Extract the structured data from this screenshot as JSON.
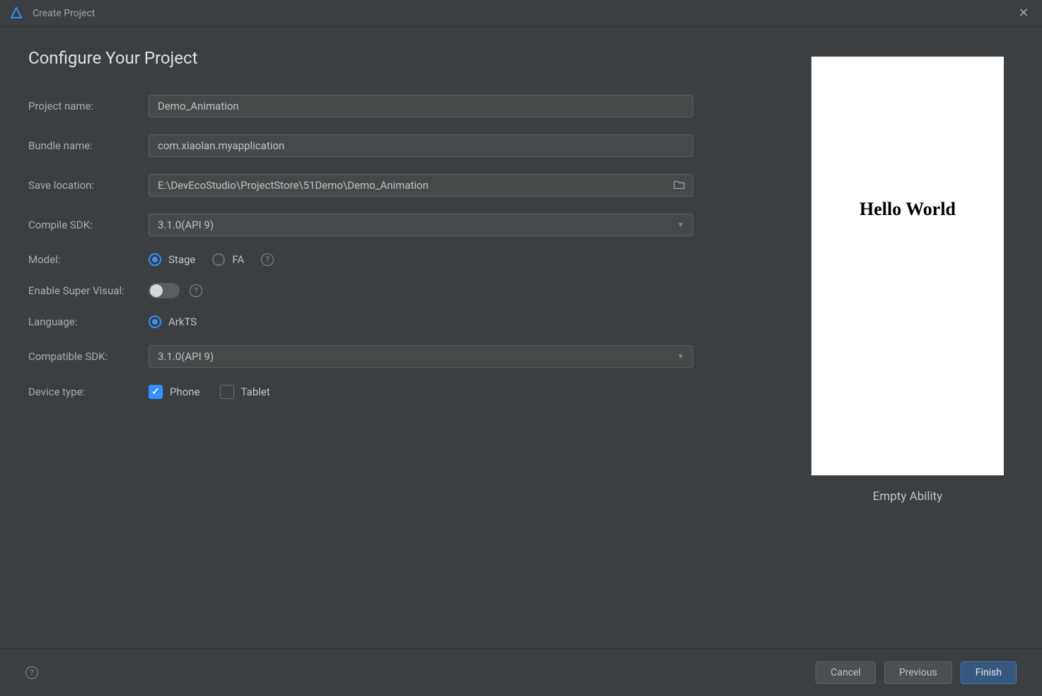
{
  "window": {
    "title": "Create Project"
  },
  "heading": "Configure Your Project",
  "form": {
    "project_name": {
      "label": "Project name:",
      "value": "Demo_Animation"
    },
    "bundle_name": {
      "label": "Bundle name:",
      "value": "com.xiaolan.myapplication"
    },
    "save_location": {
      "label": "Save location:",
      "value": "E:\\DevEcoStudio\\ProjectStore\\51Demo\\Demo_Animation"
    },
    "compile_sdk": {
      "label": "Compile SDK:",
      "value": "3.1.0(API 9)"
    },
    "model": {
      "label": "Model:",
      "options": {
        "stage": "Stage",
        "fa": "FA"
      },
      "selected": "stage"
    },
    "enable_super_visual": {
      "label": "Enable Super Visual:",
      "enabled": false
    },
    "language": {
      "label": "Language:",
      "options": {
        "arkts": "ArkTS"
      },
      "selected": "arkts"
    },
    "compatible_sdk": {
      "label": "Compatible SDK:",
      "value": "3.1.0(API 9)"
    },
    "device_type": {
      "label": "Device type:",
      "options": {
        "phone": "Phone",
        "tablet": "Tablet"
      },
      "checked": [
        "phone"
      ]
    }
  },
  "preview": {
    "content": "Hello World",
    "caption": "Empty Ability"
  },
  "footer": {
    "cancel": "Cancel",
    "previous": "Previous",
    "finish": "Finish"
  }
}
